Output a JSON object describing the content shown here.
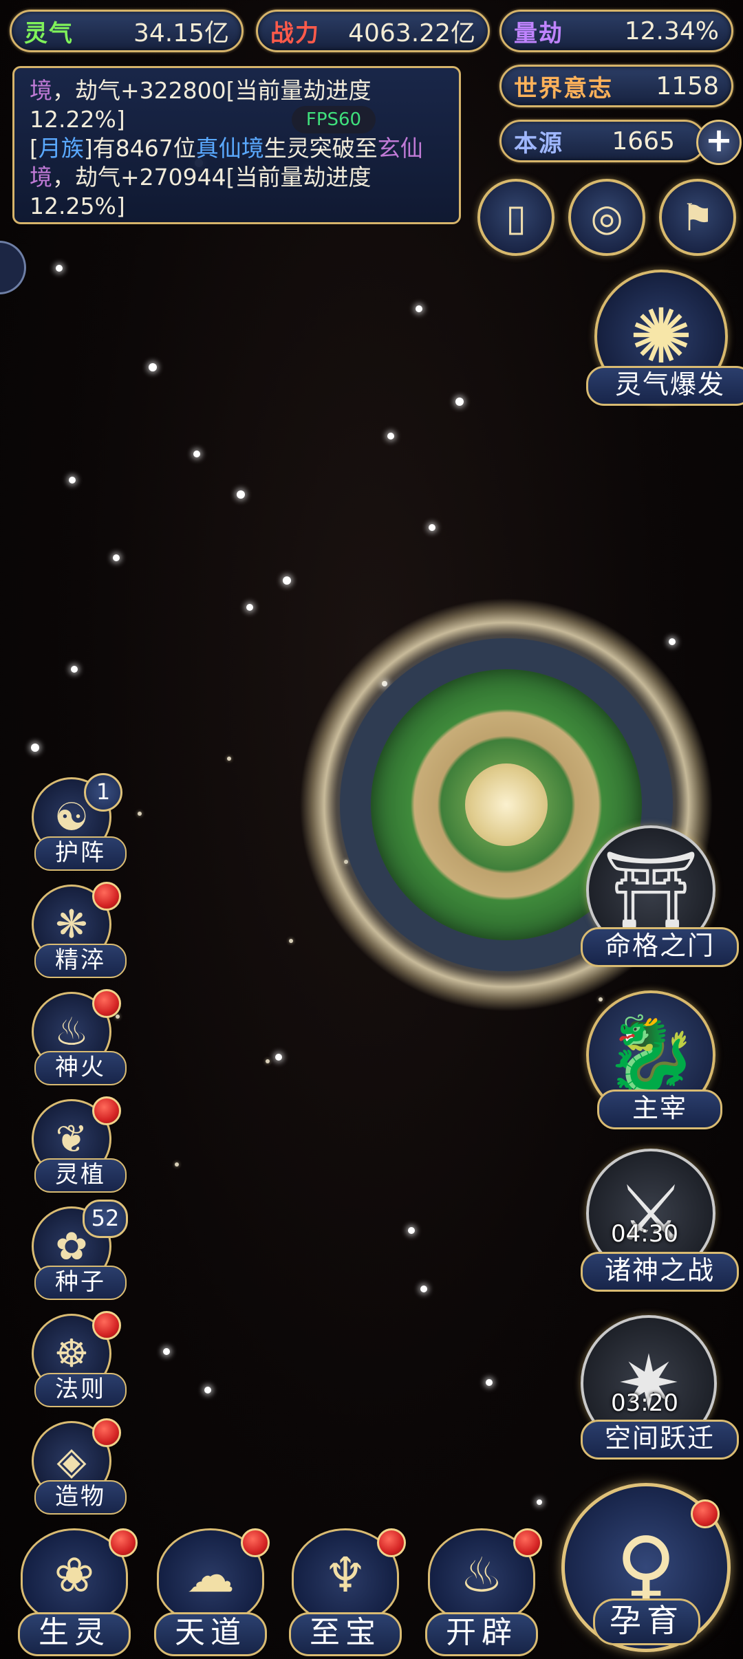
{
  "resources": {
    "lingqi": {
      "label": "灵气",
      "value": "34.15亿",
      "color": "#7ff25a"
    },
    "zhanli": {
      "label": "战力",
      "value": "4063.22亿",
      "color": "#ff5a4a"
    },
    "liangjie": {
      "label": "量劫",
      "value": "12.34%",
      "color": "#c084ff"
    },
    "shijieyizhi": {
      "label": "世界意志",
      "value": "1158",
      "color": "#ffb25a"
    },
    "benyuan": {
      "label": "本源",
      "value": "1665",
      "color": "#9fb7ff"
    }
  },
  "messages": {
    "line1_a": "境",
    "line1_b": "，劫气+322800[当前量劫进度",
    "line2": "12.22%]",
    "line3_a": "[",
    "line3_b": "月族",
    "line3_c": "]有8467位",
    "line3_d": "真仙境",
    "line3_e": "生灵突破至",
    "line3_f": "玄仙",
    "line4_a": "境",
    "line4_b": "，劫气+270944[当前量劫进度",
    "line5": "12.25%]"
  },
  "fps": "FPS60",
  "plus": "+",
  "left_menu": [
    {
      "label": "护阵",
      "glyph": "☯",
      "badge": "1"
    },
    {
      "label": "精淬",
      "glyph": "❋"
    },
    {
      "label": "神火",
      "glyph": "♨"
    },
    {
      "label": "灵植",
      "glyph": "❦"
    },
    {
      "label": "种子",
      "glyph": "✿",
      "badge": "52"
    },
    {
      "label": "法则",
      "glyph": "☸"
    },
    {
      "label": "造物",
      "glyph": "◈"
    }
  ],
  "right_menu": {
    "burst": {
      "label": "灵气爆发",
      "glyph": "✺"
    },
    "gate": {
      "label": "命格之门",
      "glyph": "⛩"
    },
    "master": {
      "label": "主宰",
      "glyph": "🐉"
    },
    "gods_war": {
      "label": "诸神之战",
      "timer": "04:30",
      "glyph": "⚔"
    },
    "space_jump": {
      "label": "空间跃迁",
      "timer": "03:20",
      "glyph": "✷"
    }
  },
  "top_icons": [
    {
      "glyph": "▯"
    },
    {
      "glyph": "◎"
    },
    {
      "glyph": "⚑"
    }
  ],
  "bottom_menu": [
    {
      "label": "生灵",
      "glyph": "❀"
    },
    {
      "label": "天道",
      "glyph": "☁"
    },
    {
      "label": "至宝",
      "glyph": "♆"
    },
    {
      "label": "开辟",
      "glyph": "♨"
    },
    {
      "label": "孕育",
      "glyph": "♀"
    }
  ]
}
